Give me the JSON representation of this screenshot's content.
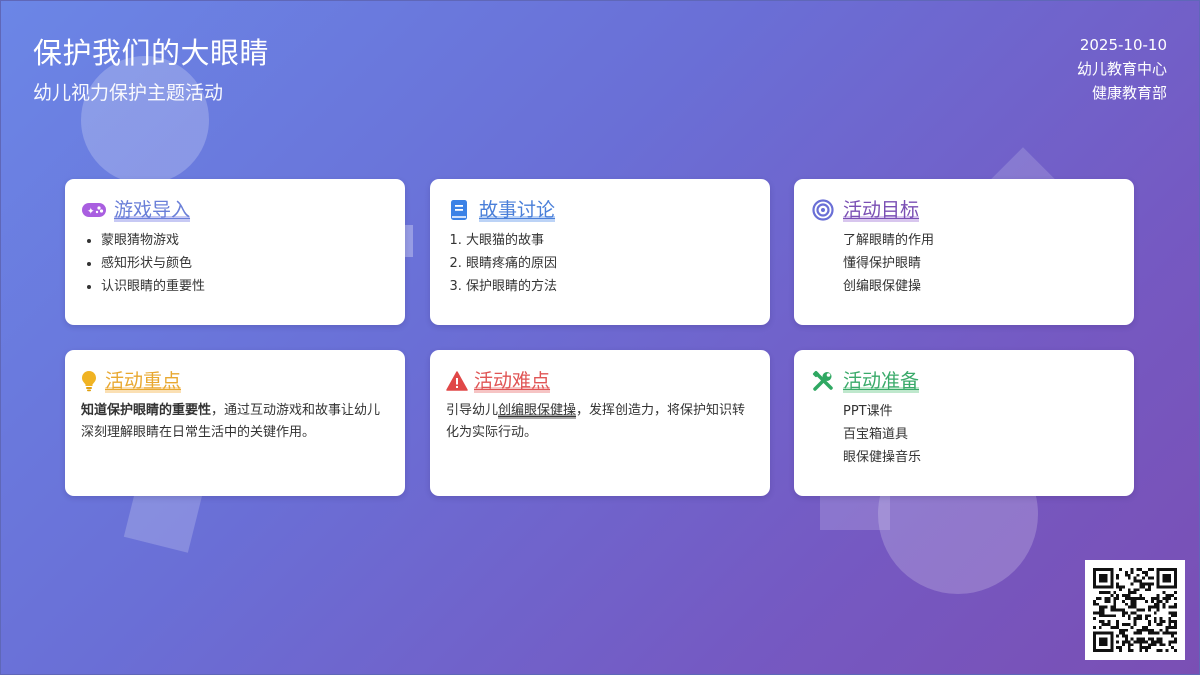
{
  "header": {
    "title": "保护我们的大眼睛",
    "subtitle": "幼儿视力保护主题活动",
    "date": "2025-10-10",
    "org": "幼儿教育中心",
    "dept": "健康教育部"
  },
  "cards": {
    "game": {
      "title": "游戏导入",
      "icon": "gamepad-icon",
      "color": "#8b6fd9",
      "items": [
        "蒙眼猜物游戏",
        "感知形状与颜色",
        "认识眼睛的重要性"
      ]
    },
    "story": {
      "title": "故事讨论",
      "icon": "book-icon",
      "color": "#4a7fd9",
      "items": [
        "大眼猫的故事",
        "眼睛疼痛的原因",
        "保护眼睛的方法"
      ]
    },
    "goal": {
      "title": "活动目标",
      "icon": "target-icon",
      "color": "#7a4fb4",
      "items": [
        "了解眼睛的作用",
        "懂得保护眼睛",
        "创编眼保健操"
      ]
    },
    "key": {
      "title": "活动重点",
      "icon": "lightbulb-icon",
      "color": "#e8a830",
      "bold": "知道保护眼睛的重要性",
      "rest": "，通过互动游戏和故事让幼儿深刻理解眼睛在日常生活中的关键作用。"
    },
    "difficulty": {
      "title": "活动难点",
      "icon": "warning-icon",
      "color": "#e05555",
      "pre": "引导幼儿",
      "highlight": "创编眼保健操",
      "post": "，发挥创造力，将保护知识转化为实际行动。"
    },
    "prep": {
      "title": "活动准备",
      "icon": "tools-icon",
      "color": "#3aaa6a",
      "items": [
        "PPT课件",
        "百宝箱道具",
        "眼保健操音乐"
      ]
    }
  }
}
